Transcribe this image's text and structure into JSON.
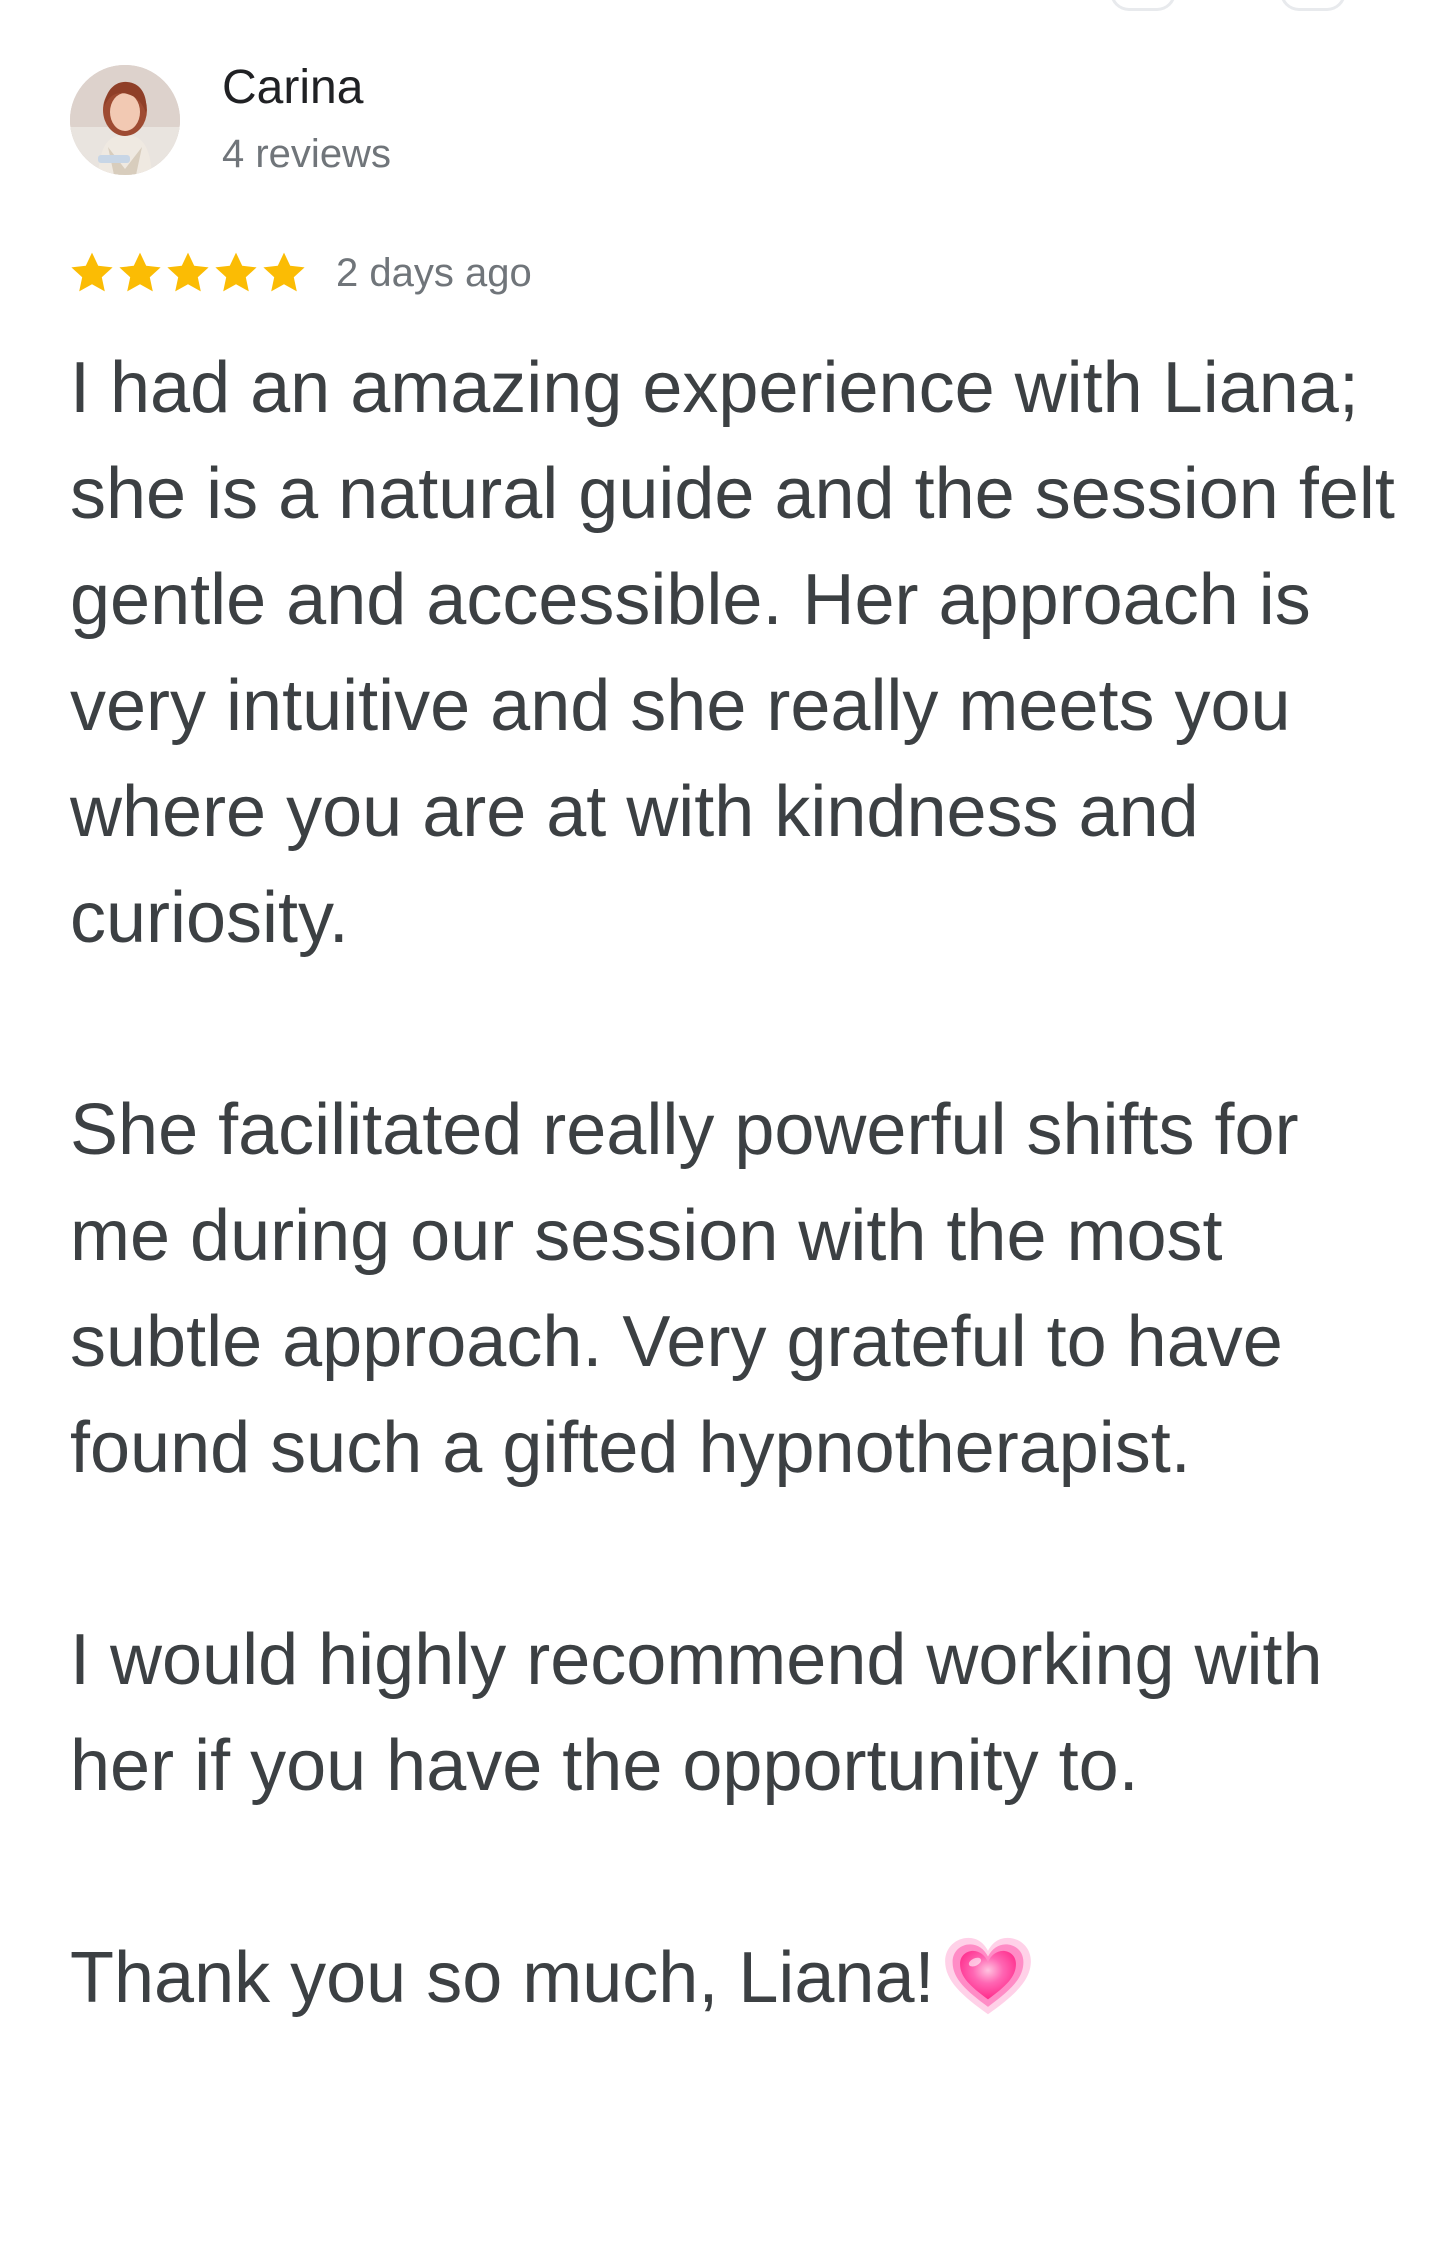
{
  "reviewer": {
    "name": "Carina",
    "review_count": "4 reviews"
  },
  "review": {
    "rating": 5,
    "max_rating": 5,
    "star_color": "#fbbc04",
    "time_ago": "2 days ago",
    "paragraphs": [
      "I had an amazing experience with Liana; she is a natural guide and the session felt gentle and accessible. Her approach is very intuitive and she really meets you where you are at with kindness and curiosity.",
      "She facilitated really powerful shifts for me during our session with the most subtle approach. Very grateful to have found such a gifted hypnotherapist.",
      "I would highly recommend working with her if you have the opportunity to.",
      "Thank you so much, Liana!"
    ],
    "end_icon": "growing-heart-emoji"
  },
  "colors": {
    "text": "#3c4043",
    "secondary_text": "#70757a",
    "name_text": "#202124",
    "heart": "#ff4fa3"
  }
}
